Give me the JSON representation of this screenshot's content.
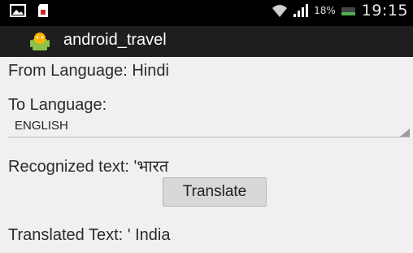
{
  "status_bar": {
    "battery_percent": "18%",
    "clock": "19:15",
    "icons": [
      "picture-icon",
      "sd-card-icon",
      "wifi-icon",
      "signal-icon",
      "battery-icon"
    ]
  },
  "action_bar": {
    "title": "android_travel",
    "icon": "android-app-icon"
  },
  "main": {
    "from_language": "From Language: Hindi",
    "to_language_label": "To Language:",
    "to_language_spinner": {
      "selected": "ENGLISH"
    },
    "recognized_text": "Recognized text: 'भारत",
    "translate_button": "Translate",
    "translated_text": "Translated Text: ' India"
  }
}
